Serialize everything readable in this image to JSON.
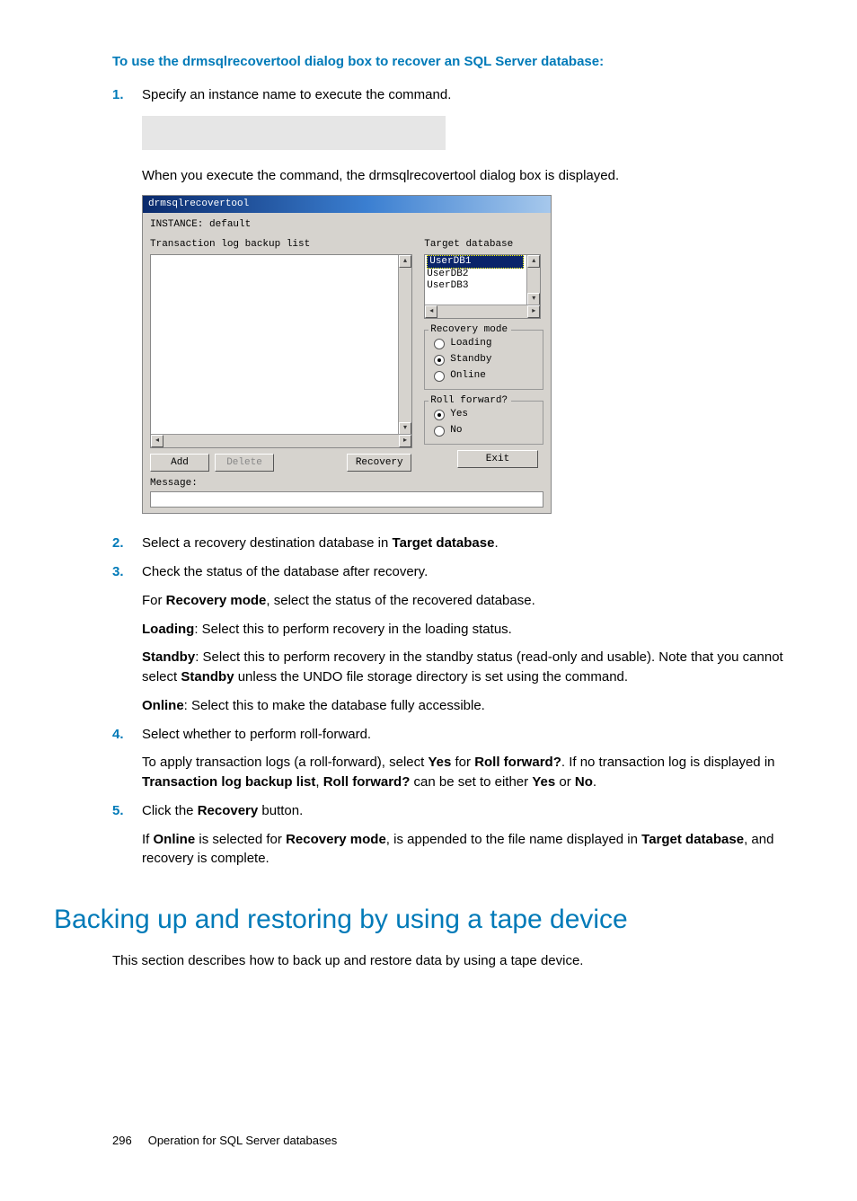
{
  "procedure_heading": "To use the drmsqlrecovertool dialog box to recover an SQL Server database:",
  "steps": {
    "s1": {
      "text_before": "Specify an instance name to execute the ",
      "text_after": " command.",
      "code": " ",
      "after_code": "When you execute the command, the drmsqlrecovertool dialog box is displayed."
    },
    "s2": {
      "text_before": "Select a recovery destination database in ",
      "bold1": "Target database",
      "text_after": "."
    },
    "s3": {
      "line1": "Check the status of the database after recovery.",
      "p1_before": "For ",
      "p1_bold": "Recovery mode",
      "p1_after": ", select the status of the recovered database.",
      "p2_bold": "Loading",
      "p2_after": ": Select this to perform recovery in the loading status.",
      "p3_bold": "Standby",
      "p3_mid": ": Select this to perform recovery in the standby status (read-only and usable). Note that you cannot select ",
      "p3_bold2": "Standby",
      "p3_after": " unless the UNDO file storage directory is set using the  command.",
      "p4_bold": "Online",
      "p4_after": ": Select this to make the database fully accessible."
    },
    "s4": {
      "line1": "Select whether to perform roll-forward.",
      "p1_before": "To apply transaction logs (a roll-forward), select ",
      "p1_b1": "Yes",
      "p1_mid1": " for ",
      "p1_b2": "Roll forward?",
      "p1_mid2": ". If no transaction log is displayed in ",
      "p1_b3": "Transaction log backup list",
      "p1_mid3": ", ",
      "p1_b4": "Roll forward?",
      "p1_mid4": " can be set to either ",
      "p1_b5": "Yes",
      "p1_mid5": " or ",
      "p1_b6": "No",
      "p1_after": "."
    },
    "s5": {
      "line1_before": "Click the ",
      "line1_bold": "Recovery",
      "line1_after": " button.",
      "p1_before": "If ",
      "p1_b1": "Online",
      "p1_mid1": " is selected for ",
      "p1_b2": "Recovery mode",
      "p1_mid2": ",    is appended to the file name displayed in ",
      "p1_b3": "Target database",
      "p1_after": ", and recovery is complete."
    }
  },
  "dialog": {
    "title": "drmsqlrecovertool",
    "instance": "INSTANCE: default",
    "left_label": "Transaction log backup list",
    "right_label": "Target database",
    "targets": [
      "UserDB1",
      "UserDB2",
      "UserDB3"
    ],
    "recovery_mode_label": "Recovery mode",
    "rm_loading": "Loading",
    "rm_standby": "Standby",
    "rm_online": "Online",
    "rf_label": "Roll forward?",
    "rf_yes": "Yes",
    "rf_no": "No",
    "btn_add": "Add",
    "btn_delete": "Delete",
    "btn_recovery": "Recovery",
    "btn_exit": "Exit",
    "msg_label": "Message:"
  },
  "section_heading": "Backing up and restoring by using a tape device",
  "section_desc": "This section describes how to back up and restore data by using a tape device.",
  "footer": {
    "page": "296",
    "title": "Operation for SQL Server databases"
  }
}
